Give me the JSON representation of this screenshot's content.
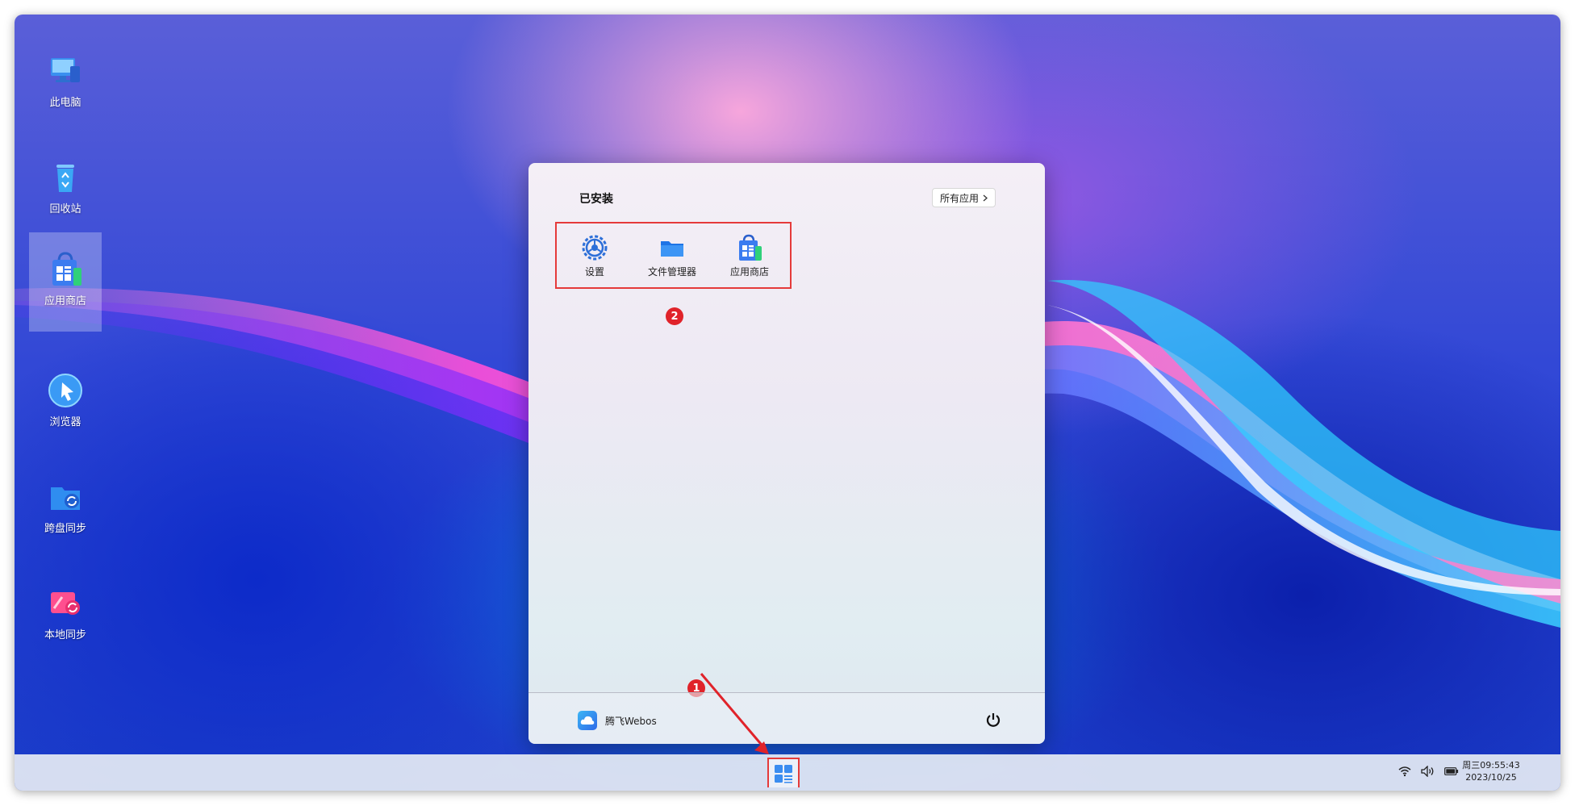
{
  "desktop": {
    "icons": [
      {
        "label": "此电脑",
        "icon": "computer-icon"
      },
      {
        "label": "回收站",
        "icon": "recycle-bin-icon"
      },
      {
        "label": "应用商店",
        "icon": "app-store-icon"
      },
      {
        "label": "浏览器",
        "icon": "browser-icon"
      },
      {
        "label": "跨盘同步",
        "icon": "cross-disk-sync-icon"
      },
      {
        "label": "本地同步",
        "icon": "local-sync-icon"
      }
    ]
  },
  "start_menu": {
    "section_title": "已安装",
    "all_apps_label": "所有应用",
    "apps": [
      {
        "label": "设置",
        "icon": "settings-icon"
      },
      {
        "label": "文件管理器",
        "icon": "folder-icon"
      },
      {
        "label": "应用商店",
        "icon": "app-store-icon"
      }
    ],
    "user_name": "腾飞Webos",
    "power_icon": "power-icon"
  },
  "annotations": {
    "badge_1": "1",
    "badge_2": "2",
    "highlight_color": "#e53a3a"
  },
  "taskbar": {
    "start_icon": "start-menu-icon",
    "tray_icons": [
      "wifi-icon",
      "volume-icon",
      "battery-icon"
    ],
    "clock_time": "周三09:55:43",
    "clock_date": "2023/10/25"
  }
}
